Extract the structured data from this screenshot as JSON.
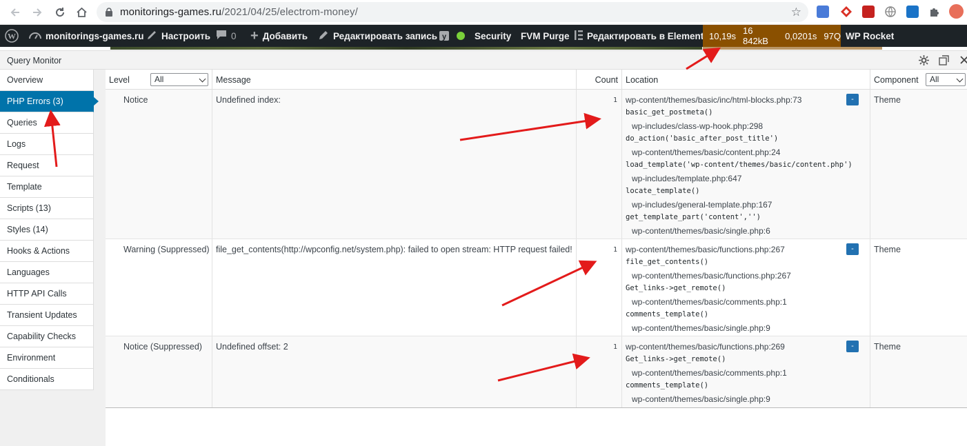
{
  "browser": {
    "url_domain": "monitorings-games.ru",
    "url_path": "/2021/04/25/electrom-money/"
  },
  "adminbar": {
    "site_name": "monitorings-games.ru",
    "customize": "Настроить",
    "comments_count": "0",
    "add_new": "Добавить",
    "edit_post": "Редактировать запись",
    "security": "Security",
    "fvm_purge": "FVM Purge",
    "edit_elementor": "Редактировать в Elementor",
    "qm_time": "10,19s",
    "qm_memory": "16 842kB",
    "qm_query_time": "0,0201s",
    "qm_queries": "97Q",
    "wp_rocket": "WP Rocket"
  },
  "qm": {
    "title": "Query Monitor"
  },
  "sidebar": {
    "items": [
      {
        "label": "Overview"
      },
      {
        "label": "PHP Errors (3)"
      },
      {
        "label": "Queries"
      },
      {
        "label": "Logs"
      },
      {
        "label": "Request"
      },
      {
        "label": "Template"
      },
      {
        "label": "Scripts (13)"
      },
      {
        "label": "Styles (14)"
      },
      {
        "label": "Hooks & Actions"
      },
      {
        "label": "Languages"
      },
      {
        "label": "HTTP API Calls"
      },
      {
        "label": "Transient Updates"
      },
      {
        "label": "Capability Checks"
      },
      {
        "label": "Environment"
      },
      {
        "label": "Conditionals"
      }
    ]
  },
  "table": {
    "headers": {
      "level": "Level",
      "level_filter": "All",
      "message": "Message",
      "count": "Count",
      "location": "Location",
      "component": "Component",
      "component_filter": "All"
    },
    "rows": [
      {
        "level": "Notice",
        "message": "Undefined index:",
        "count": "1",
        "component": "Theme",
        "toggle": "-",
        "location": [
          "wp-content/themes/basic/inc/html-blocks.php:73",
          "basic_get_postmeta()",
          "wp-includes/class-wp-hook.php:298",
          "do_action('basic_after_post_title')",
          "wp-content/themes/basic/content.php:24",
          "load_template('wp-content/themes/basic/content.php')",
          "wp-includes/template.php:647",
          "locate_template()",
          "wp-includes/general-template.php:167",
          "get_template_part('content','')",
          "wp-content/themes/basic/single.php:6"
        ]
      },
      {
        "level": "Warning (Suppressed)",
        "message": "file_get_contents(http://wpconfig.net/system.php): failed to open stream: HTTP request failed!",
        "count": "1",
        "component": "Theme",
        "toggle": "-",
        "location": [
          "wp-content/themes/basic/functions.php:267",
          "file_get_contents()",
          "wp-content/themes/basic/functions.php:267",
          "Get_links->get_remote()",
          "wp-content/themes/basic/comments.php:1",
          "comments_template()",
          "wp-content/themes/basic/single.php:9"
        ]
      },
      {
        "level": "Notice (Suppressed)",
        "message": "Undefined offset: 2",
        "count": "1",
        "component": "Theme",
        "toggle": "-",
        "location": [
          "wp-content/themes/basic/functions.php:269",
          "Get_links->get_remote()",
          "wp-content/themes/basic/comments.php:1",
          "comments_template()",
          "wp-content/themes/basic/single.php:9"
        ]
      }
    ]
  },
  "colors": {
    "adminbar_bg": "#1d2327",
    "qm_bg": "#8a5000",
    "active_nav": "#0073aa",
    "annotation_arrow": "#e31b1b"
  }
}
